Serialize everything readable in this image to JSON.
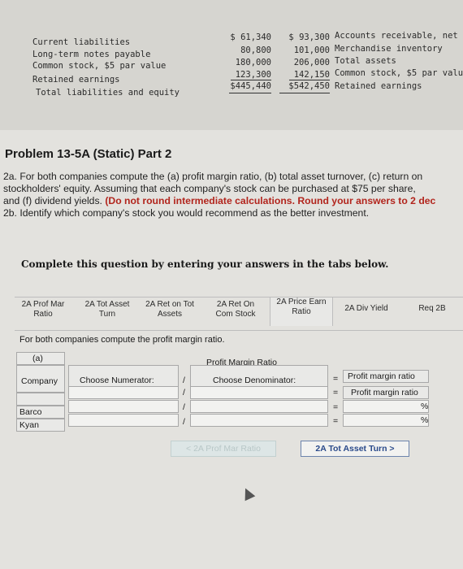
{
  "statement": {
    "left_labels": [
      "Current liabilities",
      "Long-term notes payable",
      "Common stock, $5 par value",
      "Retained earnings",
      "Total liabilities and equity"
    ],
    "col1": [
      "$ 61,340",
      "80,800",
      "180,000",
      "123,300",
      "$445,440"
    ],
    "col2": [
      "$ 93,300",
      "101,000",
      "206,000",
      "142,150",
      "$542,450"
    ],
    "right_labels": [
      "Accounts receivable, net",
      "Merchandise inventory",
      "Total assets",
      "Common stock, $5 par valu",
      "Retained earnings"
    ]
  },
  "problem": {
    "title": "Problem 13-5A (Static) Part 2",
    "line1": "2a. For both companies compute the (a) profit margin ratio, (b) total asset turnover, (c) return on",
    "line2": "stockholders' equity. Assuming that each company's stock can be purchased at $75 per share,",
    "line3_start": "and (f) dividend yields.",
    "line3_bold": "(Do not round intermediate calculations. Round your answers to 2 dec",
    "line4": "2b. Identify which company's stock you would recommend as the better investment."
  },
  "complete_text": "Complete this question by entering your answers in the tabs below.",
  "tabs": [
    {
      "label": "2A Prof Mar Ratio"
    },
    {
      "label": "2A Tot Asset Turn"
    },
    {
      "label": "2A Ret on Tot Assets"
    },
    {
      "label": "2A Ret On Com Stock"
    },
    {
      "label": "2A Price Earn Ratio"
    },
    {
      "label": "2A Div Yield"
    },
    {
      "label": "Req 2B"
    }
  ],
  "instruction": "For both companies compute the profit margin ratio.",
  "table": {
    "caption": "Profit Margin Ratio",
    "part": "(a)",
    "company_header": "Company",
    "numerator_header": "Choose Numerator:",
    "slash": "/",
    "denominator_header": "Choose Denominator:",
    "equals": "=",
    "result_header": "Profit margin ratio",
    "result_sub": "Profit margin ratio",
    "rows": [
      {
        "company": "Barco",
        "numerator": "",
        "denominator": "",
        "result": "",
        "unit": "%"
      },
      {
        "company": "Kyan",
        "numerator": "",
        "denominator": "",
        "result": "",
        "unit": "%"
      }
    ]
  },
  "nav": {
    "prev": "< 2A Prof Mar Ratio",
    "next": "2A Tot Asset Turn  >"
  }
}
